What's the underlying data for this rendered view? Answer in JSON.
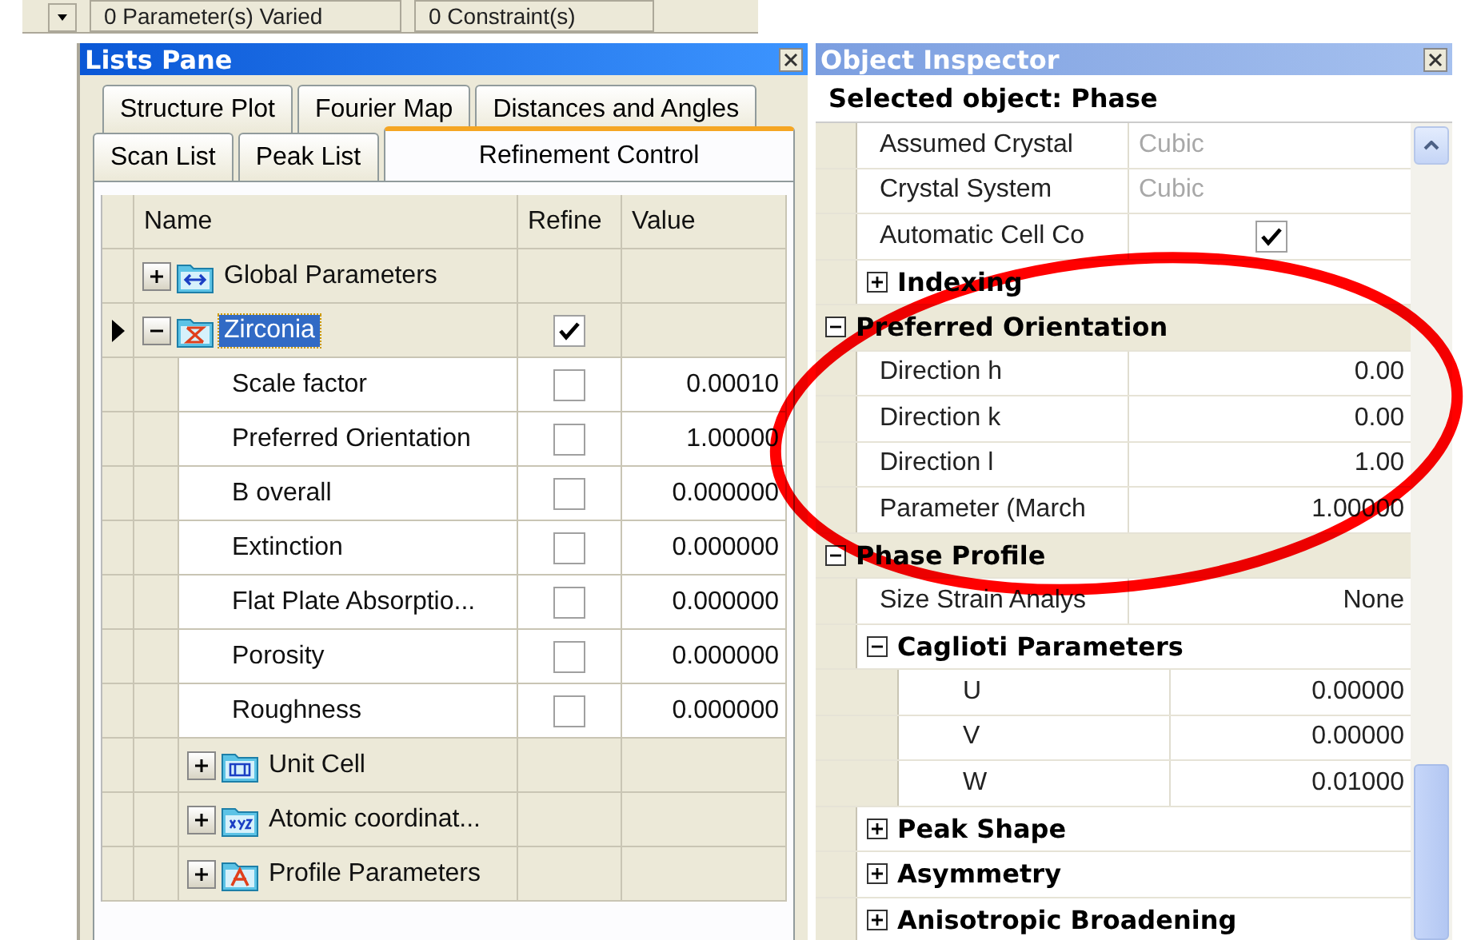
{
  "toolbar": {
    "fields": [
      "0 Parameter(s) Varied",
      "0 Constraint(s)"
    ]
  },
  "lists_pane": {
    "title": "Lists Pane",
    "tab_rows": [
      [
        {
          "label": "Structure Plot",
          "selected": false
        },
        {
          "label": "Fourier Map",
          "selected": false
        },
        {
          "label": "Distances and Angles",
          "selected": false
        }
      ],
      [
        {
          "label": "Scan List",
          "selected": false
        },
        {
          "label": "Peak List",
          "selected": false
        },
        {
          "label": "Refinement Control",
          "selected": true
        }
      ]
    ],
    "table": {
      "columns": [
        "Name",
        "Refine",
        "Value"
      ],
      "rows": [
        {
          "kind": "global",
          "label": "Global Parameters",
          "expanded": false,
          "current": false,
          "selected": false
        },
        {
          "kind": "phase",
          "label": "Zirconia",
          "expanded": true,
          "current": true,
          "selected": true,
          "checked": true,
          "children": [
            {
              "kind": "parameter",
              "label": "Scale factor",
              "checked": false,
              "value": "0.00010"
            },
            {
              "kind": "parameter",
              "label": "Preferred Orientation",
              "checked": false,
              "value": "1.00000"
            },
            {
              "kind": "parameter",
              "label": "B overall",
              "checked": false,
              "value": "0.000000"
            },
            {
              "kind": "parameter",
              "label": "Extinction",
              "checked": false,
              "value": "0.000000"
            },
            {
              "kind": "parameter",
              "label": "Flat Plate Absorptio...",
              "checked": false,
              "value": "0.000000"
            },
            {
              "kind": "parameter",
              "label": "Porosity",
              "checked": false,
              "value": "0.000000"
            },
            {
              "kind": "parameter",
              "label": "Roughness",
              "checked": false,
              "value": "0.000000"
            },
            {
              "kind": "cell",
              "label": "Unit Cell",
              "expanded": false
            },
            {
              "kind": "coordinates",
              "label": "Atomic coordinat...",
              "expanded": false
            },
            {
              "kind": "profile",
              "label": "Profile Parameters",
              "expanded": false
            }
          ]
        }
      ]
    }
  },
  "inspector": {
    "title": "Object Inspector",
    "header": "Selected object: Phase",
    "continued_rows": [
      {
        "kind": "property",
        "label": "Assumed Crystal",
        "value": "Cubic",
        "disabled": true
      },
      {
        "kind": "property",
        "label": "Crystal System",
        "value": "Cubic",
        "disabled": true
      },
      {
        "kind": "check",
        "label": "Automatic Cell Co",
        "checked": true
      },
      {
        "kind": "section",
        "label": "Indexing",
        "expanded": false
      }
    ],
    "rows": [
      {
        "kind": "section",
        "label": "Preferred Orientation",
        "expanded": true,
        "children": [
          {
            "kind": "property",
            "label": "Direction h",
            "value": "0.00",
            "disabled": false
          },
          {
            "kind": "property",
            "label": "Direction k",
            "value": "0.00",
            "disabled": false
          },
          {
            "kind": "property",
            "label": "Direction l",
            "value": "1.00",
            "disabled": false
          },
          {
            "kind": "property",
            "label": "Parameter (March",
            "value": "1.00000",
            "disabled": false
          }
        ]
      },
      {
        "kind": "section",
        "label": "Phase Profile",
        "expanded": true,
        "children": [
          {
            "kind": "property",
            "label": "Size Strain Analys",
            "value": "None",
            "disabled": false
          },
          {
            "kind": "section",
            "label": "Caglioti Parameters",
            "expanded": true,
            "children": [
              {
                "kind": "property",
                "label": "U",
                "value": "0.00000",
                "disabled": false
              },
              {
                "kind": "property",
                "label": "V",
                "value": "0.00000",
                "disabled": false
              },
              {
                "kind": "property",
                "label": "W",
                "value": "0.01000",
                "disabled": false
              }
            ]
          },
          {
            "kind": "section",
            "label": "Peak Shape",
            "expanded": false
          },
          {
            "kind": "section",
            "label": "Asymmetry",
            "expanded": false
          },
          {
            "kind": "section",
            "label": "Anisotropic Broadening",
            "expanded": false
          }
        ]
      }
    ]
  },
  "annotation": {
    "kind": "ellipse"
  }
}
